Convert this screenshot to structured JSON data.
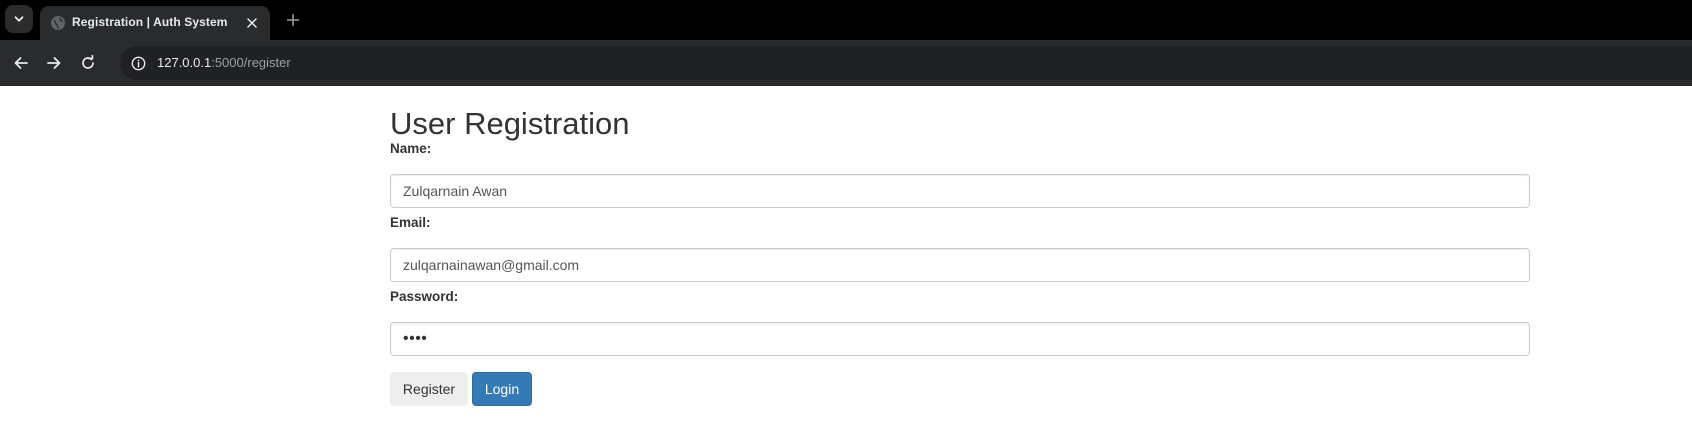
{
  "browser": {
    "tab_title": "Registration | Auth System",
    "url_host": "127.0.0.1",
    "url_path": ":5000/register",
    "icons": {
      "tab_search": "chevron-down-icon",
      "favicon": "globe-icon",
      "close": "close-icon",
      "new_tab": "plus-icon",
      "back": "arrow-left-icon",
      "forward": "arrow-right-icon",
      "reload": "reload-icon",
      "site_info": "info-icon"
    }
  },
  "form": {
    "title": "User Registration",
    "name_label": "Name:",
    "name_value": "Zulqarnain Awan",
    "email_label": "Email:",
    "email_value": "zulqarnainawan@gmail.com",
    "password_label": "Password:",
    "password_value": "••••",
    "register_label": "Register",
    "login_label": "Login"
  },
  "colors": {
    "chrome_dark": "#000000",
    "toolbar": "#2a2b2d",
    "primary_button": "#337ab7",
    "default_button": "#eeeeee",
    "input_border": "#cccccc"
  }
}
